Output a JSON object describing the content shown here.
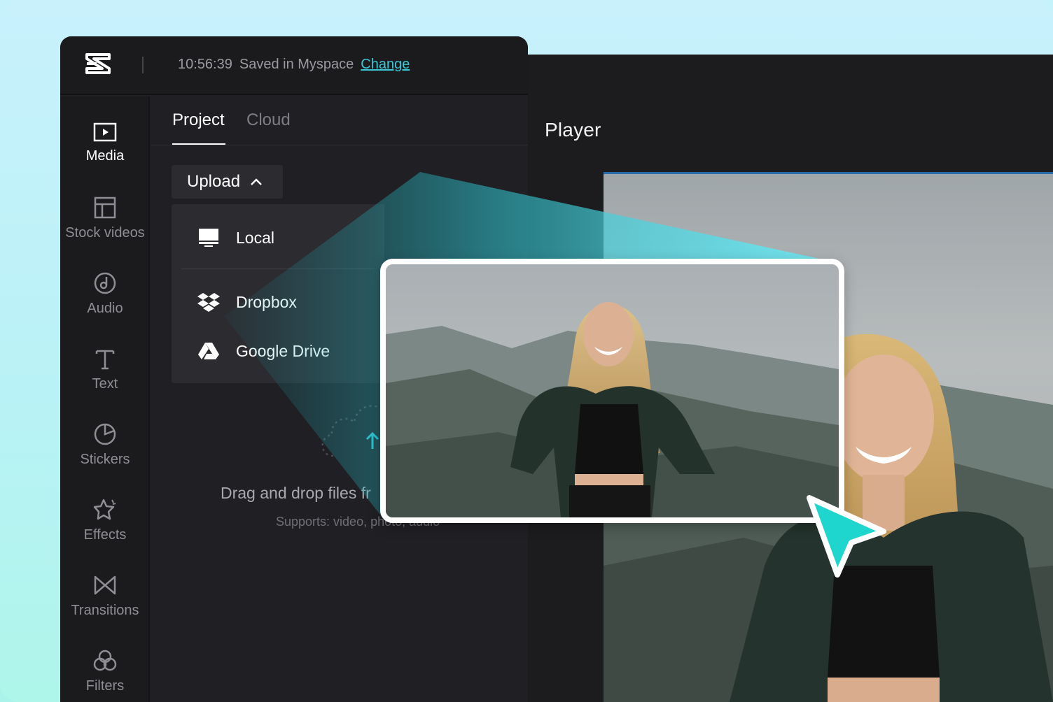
{
  "topbar": {
    "time": "10:56:39",
    "saved_text": "Saved in Myspace",
    "change_label": "Change"
  },
  "sidebar": {
    "items": [
      {
        "label": "Media",
        "icon": "media-icon",
        "active": true
      },
      {
        "label": "Stock videos",
        "icon": "stock-videos-icon",
        "active": false
      },
      {
        "label": "Audio",
        "icon": "audio-icon",
        "active": false
      },
      {
        "label": "Text",
        "icon": "text-icon",
        "active": false
      },
      {
        "label": "Stickers",
        "icon": "stickers-icon",
        "active": false
      },
      {
        "label": "Effects",
        "icon": "effects-icon",
        "active": false
      },
      {
        "label": "Transitions",
        "icon": "transitions-icon",
        "active": false
      },
      {
        "label": "Filters",
        "icon": "filters-icon",
        "active": false
      }
    ]
  },
  "tabs": [
    {
      "label": "Project",
      "active": true
    },
    {
      "label": "Cloud",
      "active": false
    }
  ],
  "upload": {
    "label": "Upload",
    "menu": [
      {
        "label": "Local",
        "icon": "monitor-icon"
      },
      {
        "label": "Dropbox",
        "icon": "dropbox-icon"
      },
      {
        "label": "Google Drive",
        "icon": "google-drive-icon"
      }
    ]
  },
  "dropzone": {
    "title": "Drag and drop files fr",
    "subtitle": "Supports: video, photo, audio"
  },
  "player": {
    "title": "Player"
  },
  "colors": {
    "accent": "#3cc7d6",
    "cursor": "#1fd6cf",
    "panel_bg": "#202024",
    "sidebar_bg": "#1b1b1e"
  }
}
